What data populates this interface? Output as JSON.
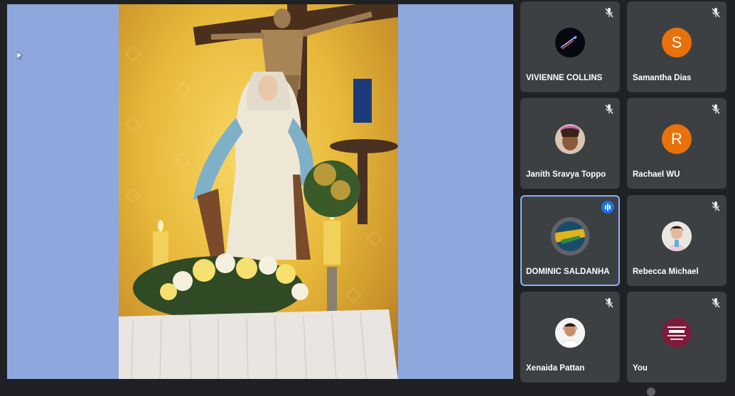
{
  "shared_screen": {
    "description_icon": "presentation-image"
  },
  "participants": [
    {
      "name": "VIVIENNE COLLINS",
      "avatar": "photo",
      "muted": true
    },
    {
      "name": "Samantha Dias",
      "avatar": "letter",
      "initial": "S",
      "muted": true
    },
    {
      "name": "Janith Sravya Toppo",
      "avatar": "photo",
      "muted": true
    },
    {
      "name": "Rachael WU",
      "avatar": "letter",
      "initial": "R",
      "muted": true
    },
    {
      "name": "DOMINIC SALDANHA",
      "avatar": "photo",
      "muted": false,
      "speaking": true
    },
    {
      "name": "Rebecca Michael",
      "avatar": "photo",
      "muted": true
    },
    {
      "name": "Xenaida Pattan",
      "avatar": "photo",
      "muted": true
    },
    {
      "name": "You",
      "avatar": "photo",
      "muted": true
    }
  ],
  "colors": {
    "background": "#202124",
    "tile": "#3c4043",
    "stage": "#8ea8de",
    "active_border": "#8ab4f8",
    "avatar_letter_bg": "#e8710a",
    "speaking_badge": "#1a73e8"
  }
}
